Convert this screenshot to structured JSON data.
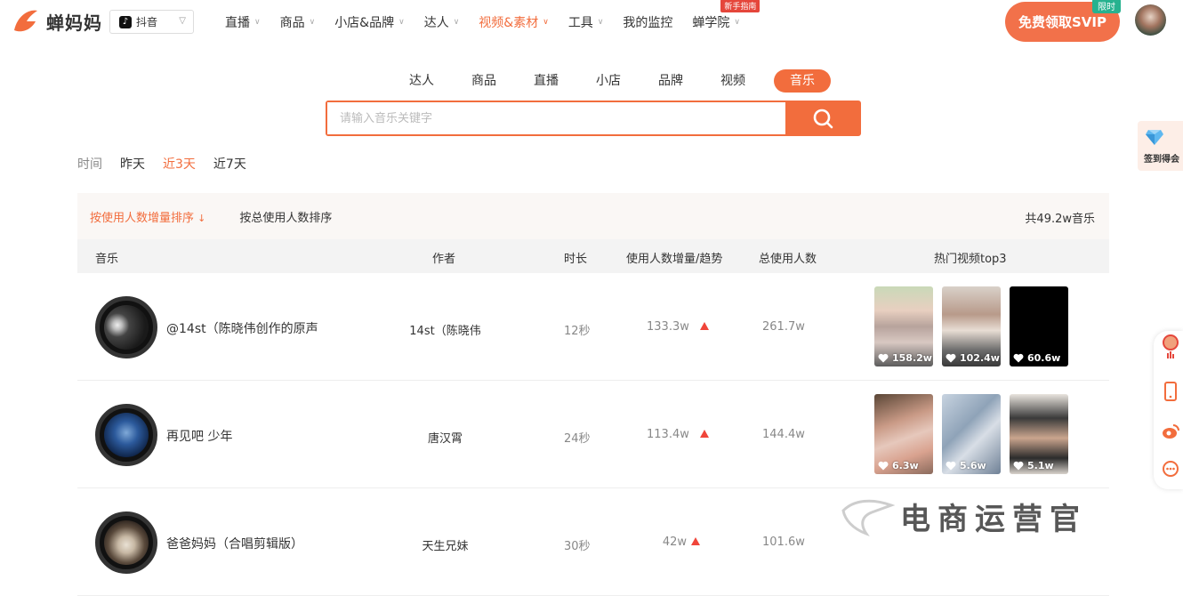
{
  "brand": {
    "name": "蝉妈妈",
    "accent": "#f26d3d"
  },
  "platform": {
    "label": "抖音"
  },
  "nav": {
    "items": [
      {
        "label": "直播",
        "dropdown": true
      },
      {
        "label": "商品",
        "dropdown": true
      },
      {
        "label": "小店&品牌",
        "dropdown": true
      },
      {
        "label": "达人",
        "dropdown": true
      },
      {
        "label": "视频&素材",
        "dropdown": true,
        "active": true
      },
      {
        "label": "工具",
        "dropdown": true
      },
      {
        "label": "我的监控",
        "dropdown": false
      },
      {
        "label": "蝉学院",
        "dropdown": true,
        "badge": "新手指南"
      }
    ]
  },
  "svip": {
    "label": "免费领取SVIP",
    "badge": "限时"
  },
  "tabs": [
    "达人",
    "商品",
    "直播",
    "小店",
    "品牌",
    "视频",
    "音乐"
  ],
  "active_tab": "音乐",
  "search": {
    "placeholder": "请输入音乐关键字",
    "value": ""
  },
  "time_filter": {
    "label": "时间",
    "options": [
      "昨天",
      "近3天",
      "近7天"
    ],
    "active": "近3天"
  },
  "sort": {
    "options": [
      "按使用人数增量排序",
      "按总使用人数排序"
    ],
    "active": "按使用人数增量排序",
    "total": "共49.2w音乐"
  },
  "columns": [
    "音乐",
    "作者",
    "时长",
    "使用人数增量/趋势",
    "总使用人数",
    "热门视频top3"
  ],
  "rows": [
    {
      "name": "@14st（陈晓伟创作的原声",
      "author": "14st（陈晓伟",
      "duration": "12秒",
      "increase": "133.3w",
      "trend": "up",
      "total": "261.7w",
      "videos": [
        {
          "likes": "158.2w"
        },
        {
          "likes": "102.4w"
        },
        {
          "likes": "60.6w"
        }
      ]
    },
    {
      "name": "再见吧 少年",
      "author": "唐汉霄",
      "duration": "24秒",
      "increase": "113.4w",
      "trend": "up",
      "total": "144.4w",
      "videos": [
        {
          "likes": "6.3w"
        },
        {
          "likes": "5.6w"
        },
        {
          "likes": "5.1w"
        }
      ]
    },
    {
      "name": "爸爸妈妈（合唱剪辑版）",
      "author": "天生兄妹",
      "duration": "30秒",
      "increase": "42w",
      "trend": "up",
      "total": "101.6w",
      "videos": []
    }
  ],
  "sidecard": {
    "label": "签到得会"
  },
  "watermark": {
    "text": "电商运营官"
  }
}
